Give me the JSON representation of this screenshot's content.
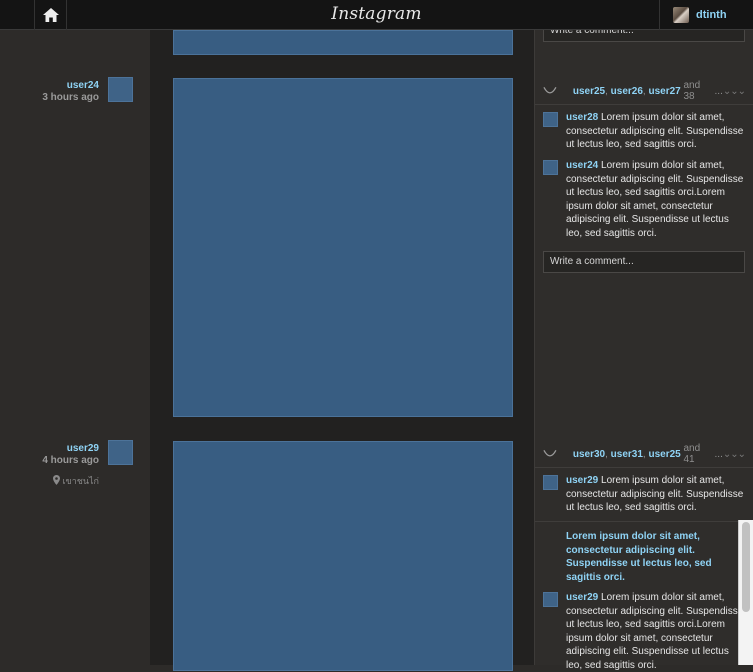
{
  "header": {
    "logo": "Instagram",
    "username": "dtinth"
  },
  "colors": {
    "accent": "#8fd3f5",
    "photo_fill": "#385d82",
    "background": "#2d2b29"
  },
  "posts": [
    {
      "comment_placeholder": "Write a comment..."
    },
    {
      "author": "user24",
      "time": "3 hours ago",
      "likes": {
        "users": [
          "user25",
          "user26",
          "user27"
        ],
        "and_more": "and 38",
        "ellipsis": "..."
      },
      "comments": [
        {
          "user": "user28",
          "text": "Lorem ipsum dolor sit amet, consectetur adipiscing elit. Suspendisse ut lectus leo, sed sagittis orci."
        },
        {
          "user": "user24",
          "text": "Lorem ipsum dolor sit amet, consectetur adipiscing elit. Suspendisse ut lectus leo, sed sagittis orci.Lorem ipsum dolor sit amet, consectetur adipiscing elit. Suspendisse ut lectus leo, sed sagittis orci."
        }
      ],
      "comment_placeholder": "Write a comment..."
    },
    {
      "author": "user29",
      "time": "4 hours ago",
      "location": "เขาชนไก่",
      "likes": {
        "users": [
          "user30",
          "user31",
          "user25"
        ],
        "and_more": "and 41",
        "ellipsis": "..."
      },
      "comments": [
        {
          "user": "user29",
          "text": "Lorem ipsum dolor sit amet, consectetur adipiscing elit. Suspendisse ut lectus leo, sed sagittis orci."
        }
      ],
      "caption": "Lorem ipsum dolor sit amet, consectetur adipiscing elit. Suspendisse ut lectus leo, sed sagittis orci.",
      "comments_more": [
        {
          "user": "user29",
          "text": "Lorem ipsum dolor sit amet, consectetur adipiscing elit. Suspendisse ut lectus leo, sed sagittis orci.Lorem ipsum dolor sit amet, consectetur adipiscing elit. Suspendisse ut lectus leo, sed sagittis orci."
        }
      ]
    }
  ]
}
